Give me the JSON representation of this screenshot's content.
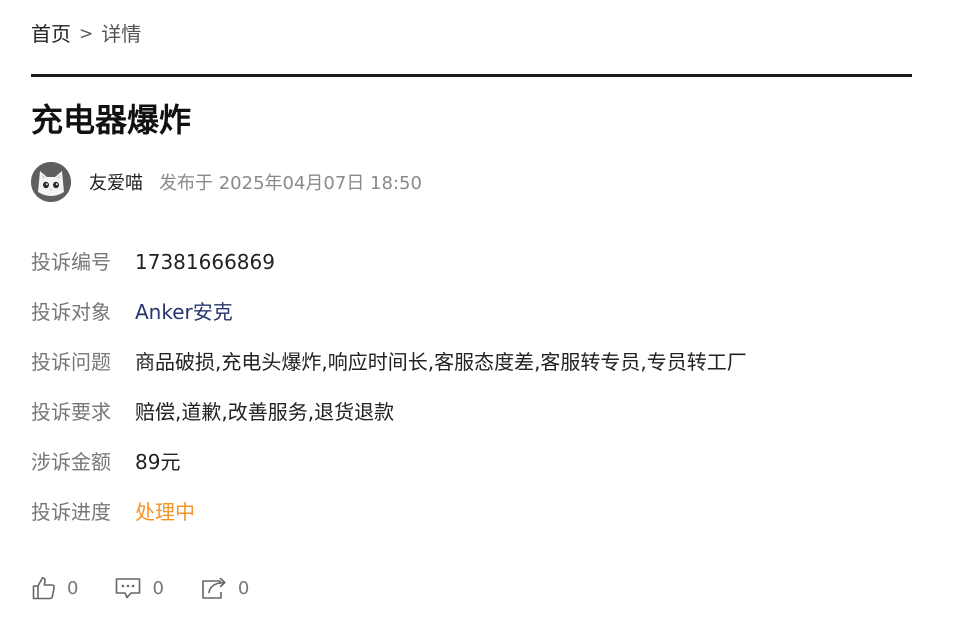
{
  "breadcrumb": {
    "home": "首页",
    "separator": ">",
    "current": "详情"
  },
  "article": {
    "title": "充电器爆炸",
    "author": "友爱喵",
    "published": "发布于 2025年04月07日 18:50"
  },
  "info": [
    {
      "label": "投诉编号",
      "value": "17381666869"
    },
    {
      "label": "投诉对象",
      "value": "Anker安克"
    },
    {
      "label": "投诉问题",
      "value": "商品破损,充电头爆炸,响应时间长,客服态度差,客服转专员,专员转工厂"
    },
    {
      "label": "投诉要求",
      "value": "赔偿,道歉,改善服务,退货退款"
    },
    {
      "label": "涉诉金额",
      "value": "89元"
    },
    {
      "label": "投诉进度",
      "value": "处理中"
    }
  ],
  "actions": {
    "like": {
      "icon": "thumbs-up-icon",
      "count": "0"
    },
    "comment": {
      "icon": "comment-icon",
      "count": "0"
    },
    "share": {
      "icon": "share-icon",
      "count": "0"
    }
  },
  "colors": {
    "link": "#28356e",
    "status": "#f5942a",
    "label": "#777777",
    "divider": "#1a1a1a"
  }
}
